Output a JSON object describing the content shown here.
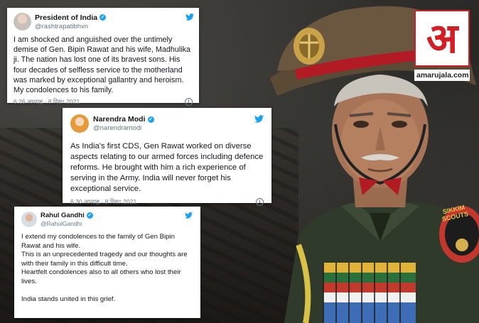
{
  "logo": {
    "glyph": "अ",
    "site": "amarujala.com",
    "brand_color": "#d21f26"
  },
  "tweets": [
    {
      "name": "President of India",
      "handle": "@rashtrapatibhvn",
      "text": "I am shocked and anguished over the untimely demise of Gen. Bipin Rawat and his wife, Madhulika ji. The nation has lost one of its bravest sons. His four decades of selfless service to the motherland was marked by exceptional gallantry and heroism. My condolences to his family.",
      "time": "6:26 अपराह्न · 8 दिस॰ 2021"
    },
    {
      "name": "Narendra Modi",
      "handle": "@narendramodi",
      "text": "As India's first CDS, Gen Rawat worked on diverse aspects relating to our armed forces including defence reforms. He brought with him a rich experience of serving in the Army. India will never forget his exceptional service.",
      "time": "6:30 अपराह्न · 8 दिस॰ 2021"
    },
    {
      "name": "Rahul Gandhi",
      "handle": "@RahulGandhi",
      "lines": [
        "I extend my condolences to the family of Gen Bipin Rawat and his wife.",
        "This is an unprecedented tragedy and our thoughts are with their family in this difficult time.",
        "Heartfelt condolences also to all others who lost their lives.",
        "",
        "India stands united in this grief."
      ]
    }
  ],
  "badge": {
    "text": "SIKKIM SCOUTS"
  },
  "colors": {
    "twitter_blue": "#1da1f2",
    "beret_red": "#b31b24",
    "uniform_green": "#2f3a2a"
  }
}
